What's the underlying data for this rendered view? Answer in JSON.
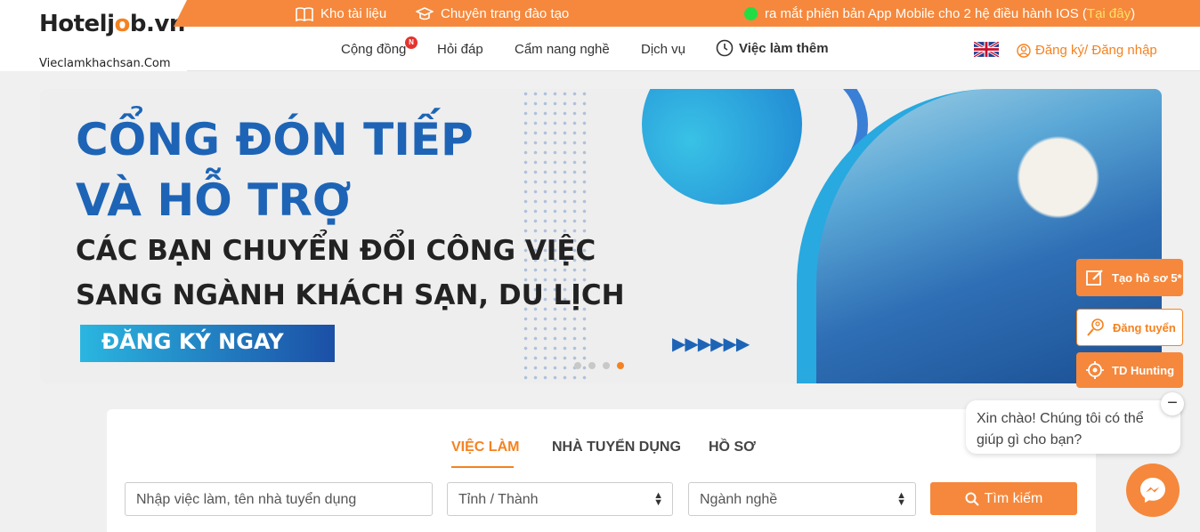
{
  "brand": {
    "logo_text": "Hoteljob.vn",
    "sub_text": "Vieclamkhachsan.Com"
  },
  "topbar": {
    "library_label": "Kho tài liệu",
    "training_label": "Chuyên trang đào tạo",
    "ticker_text": "ra mắt phiên bản App Mobile cho 2 hệ điều hành IOS (",
    "ticker_link": "Tại đây",
    "ticker_end": ")",
    "ticker_status_color": "#22dd44"
  },
  "nav": {
    "items": [
      "Cộng đồng",
      "Hỏi đáp",
      "Cẩm nang nghề",
      "Dịch vụ",
      "Việc làm thêm"
    ],
    "badge": "N",
    "login_label": "Đăng ký/ Đăng nhập"
  },
  "banner": {
    "line1": "CỔNG ĐÓN TIẾP",
    "line2": "VÀ HỖ TRỢ",
    "line3": "CÁC BẠN CHUYỂN ĐỔI CÔNG VIỆC",
    "line4": "SANG NGÀNH KHÁCH SẠN, DU LỊCH",
    "cta": "ĐĂNG KÝ NGAY",
    "arrows": "▶▶▶▶▶▶",
    "slide_count": 4,
    "active_slide": 4
  },
  "search": {
    "tabs": [
      "VIỆC LÀM",
      "NHÀ TUYỂN DỤNG",
      "HỒ SƠ"
    ],
    "active_tab": "VIỆC LÀM",
    "keyword_placeholder": "Nhập việc làm, tên nhà tuyển dụng",
    "province_selected": "Tỉnh / Thành",
    "industry_selected": "Ngành nghề",
    "submit_label": "Tìm kiếm"
  },
  "side_actions": {
    "create_cv": "Tạo hồ sơ 5*",
    "post_job": "Đăng tuyển",
    "td_hunting": "TD Hunting"
  },
  "chat": {
    "greeting": "Xin chào! Chúng tôi có thể giúp gì cho bạn?",
    "close": "−"
  },
  "colors": {
    "accent": "#f58220",
    "topbar": "#f5883c",
    "banner_blue": "#1d64b6"
  }
}
